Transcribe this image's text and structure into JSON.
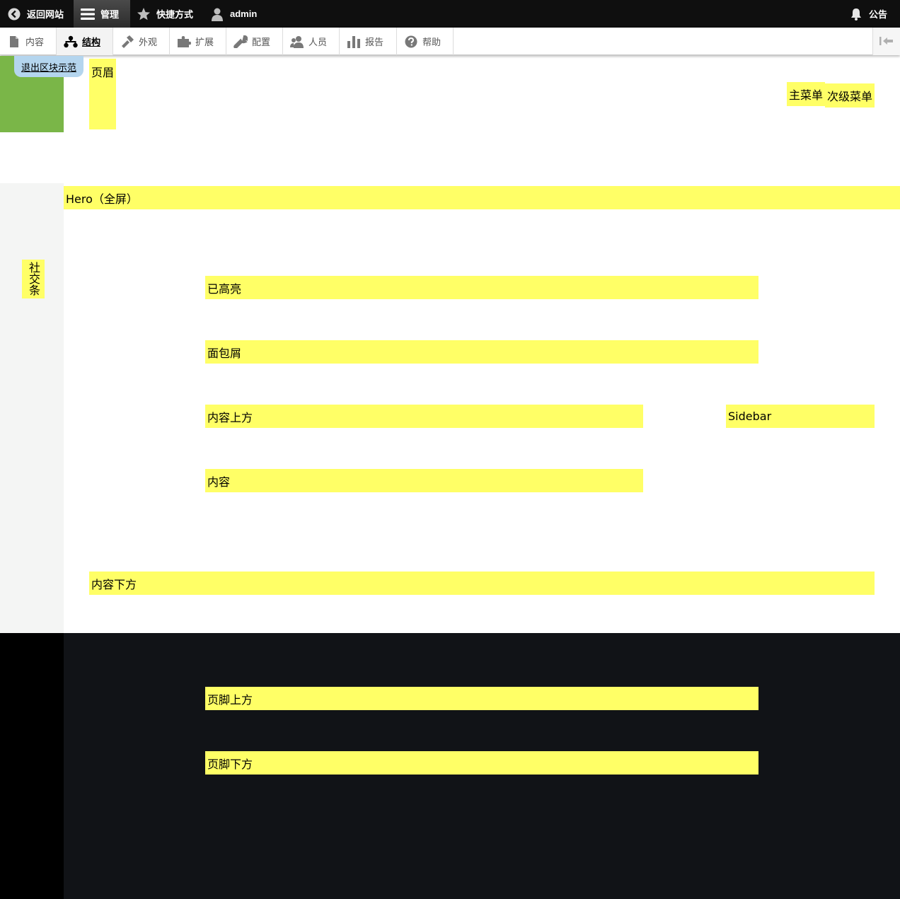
{
  "toolbar": {
    "back_to_site": "返回网站",
    "manage": "管理",
    "shortcuts": "快捷方式",
    "user": "admin",
    "announcements": "公告"
  },
  "tray": {
    "items": [
      {
        "label": "内容",
        "icon": "file-icon"
      },
      {
        "label": "结构",
        "icon": "structure-icon"
      },
      {
        "label": "外观",
        "icon": "brush-icon"
      },
      {
        "label": "扩展",
        "icon": "puzzle-icon"
      },
      {
        "label": "配置",
        "icon": "wrench-icon"
      },
      {
        "label": "人员",
        "icon": "people-icon"
      },
      {
        "label": "报告",
        "icon": "bar-chart-icon"
      },
      {
        "label": "帮助",
        "icon": "help-icon"
      }
    ],
    "active": "结构"
  },
  "demo": {
    "exit_label": "退出区块示范"
  },
  "regions": {
    "header": "页眉",
    "primary_menu": "主菜单",
    "secondary_menu": "次级菜单",
    "hero": "Hero（全屏）",
    "social": "社交条",
    "highlighted": "已高亮",
    "breadcrumb": "面包屑",
    "content_above": "内容上方",
    "sidebar": "Sidebar",
    "content": "内容",
    "content_below": "内容下方",
    "footer_top": "页脚上方",
    "footer_bottom": "页脚下方"
  },
  "colors": {
    "region_highlight": "#ffff66",
    "toolbar_bg": "#0f0f0f",
    "green_block": "#7ab648",
    "exit_button": "#b4d5ee",
    "footer_bg": "#111317"
  }
}
